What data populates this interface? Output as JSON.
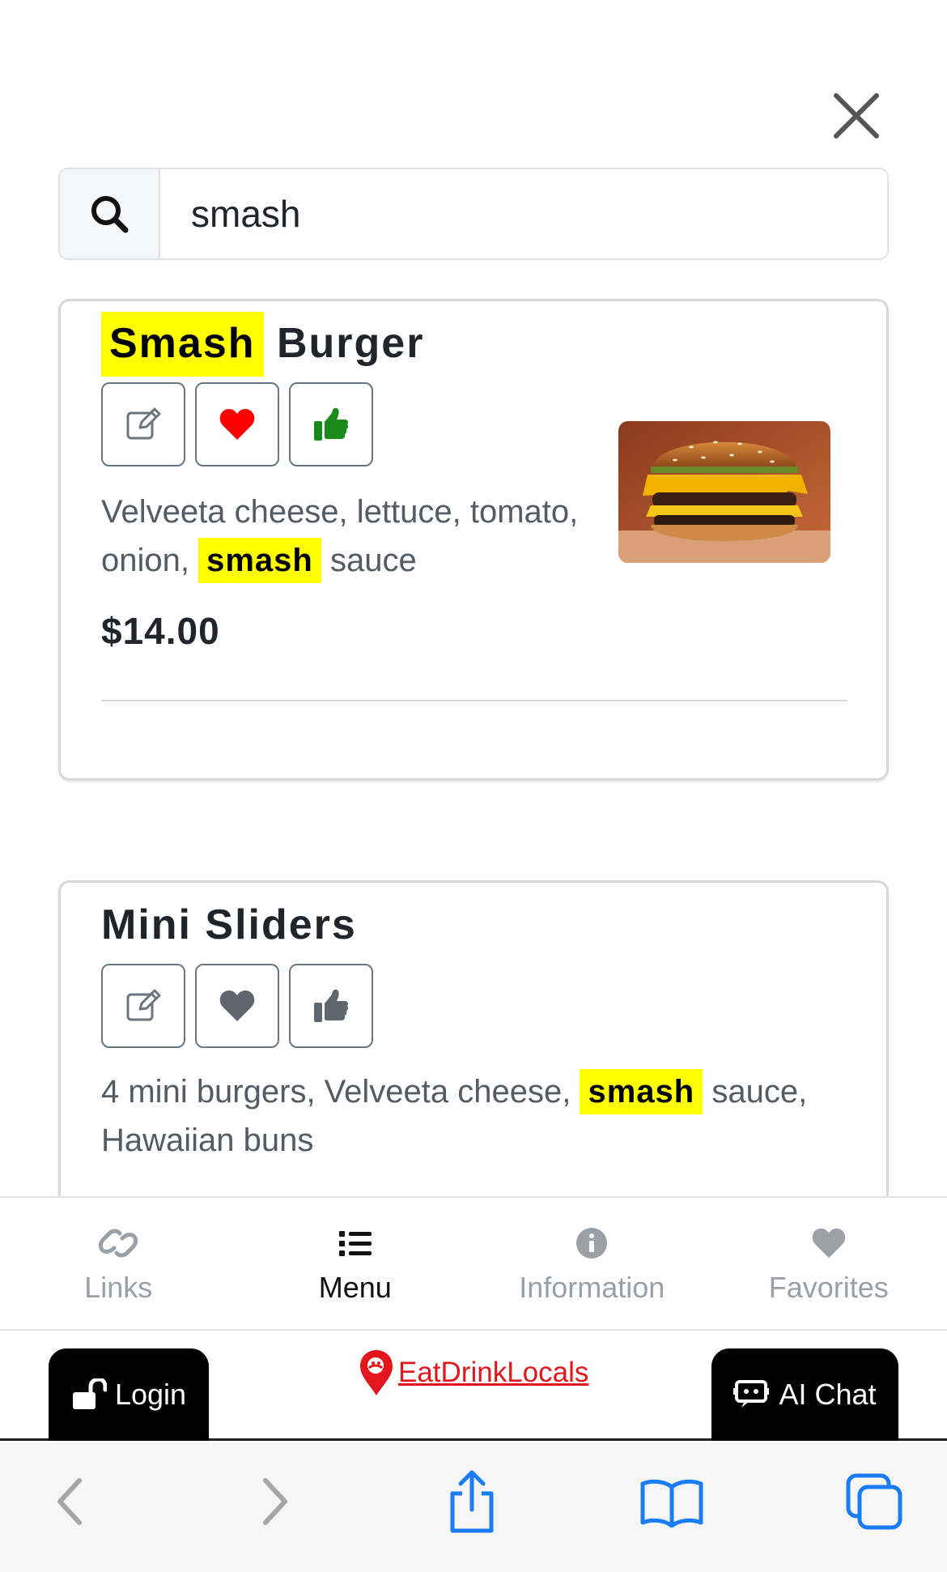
{
  "search": {
    "value": "smash",
    "placeholder": ""
  },
  "results": [
    {
      "title_highlight": "Smash",
      "title_rest": "Burger",
      "description_before": "Velveeta cheese, lettuce, tomato, onion,",
      "description_highlight": "smash",
      "description_after": "sauce",
      "price": "$14.00",
      "favorited": true,
      "liked": true
    },
    {
      "title": "Mini Sliders",
      "description_before": "4 mini burgers, Velveeta cheese,",
      "description_highlight": "smash",
      "description_after": "sauce, Hawaiian buns",
      "price": "$",
      "favorited": false,
      "liked": false
    }
  ],
  "tabs": [
    {
      "label": "Links",
      "icon": "link-icon",
      "active": false
    },
    {
      "label": "Menu",
      "icon": "list-icon",
      "active": true
    },
    {
      "label": "Information",
      "icon": "info-icon",
      "active": false
    },
    {
      "label": "Favorites",
      "icon": "heart-icon",
      "active": false
    }
  ],
  "footer": {
    "login_label": "Login",
    "brand": "EatDrinkLocals",
    "ai_chat_label": "AI Chat"
  },
  "colors": {
    "highlight": "#ffff00",
    "heart_active": "#ff0000",
    "thumb_active": "#1a8a1a",
    "brand_red": "#e3161b",
    "ios_blue": "#1a7cf5"
  }
}
